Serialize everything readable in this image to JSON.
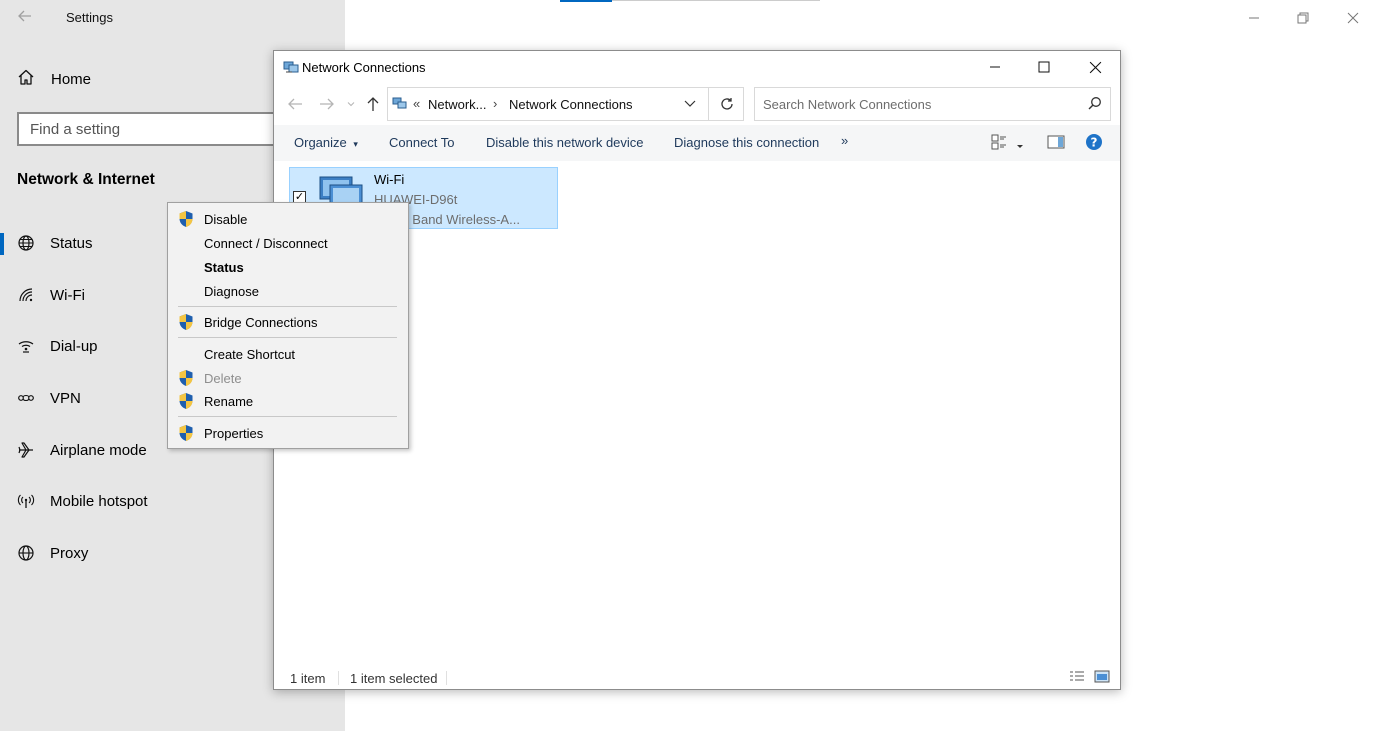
{
  "settings": {
    "title": "Settings",
    "home_label": "Home",
    "search_placeholder": "Find a setting",
    "section_heading": "Network & Internet",
    "nav": [
      {
        "label": "Status",
        "icon": "globe-icon"
      },
      {
        "label": "Wi-Fi",
        "icon": "wifi-icon"
      },
      {
        "label": "Dial-up",
        "icon": "dialup-icon"
      },
      {
        "label": "VPN",
        "icon": "vpn-icon"
      },
      {
        "label": "Airplane mode",
        "icon": "airplane-icon"
      },
      {
        "label": "Mobile hotspot",
        "icon": "hotspot-icon"
      },
      {
        "label": "Proxy",
        "icon": "globe-icon"
      }
    ],
    "active_nav": "Status",
    "accent_color": "#0067c0"
  },
  "explorer": {
    "title": "Network Connections",
    "breadcrumb": {
      "overflow": "«",
      "parent": "Network...",
      "separator": "›",
      "current": "Network Connections"
    },
    "search_placeholder": "Search Network Connections",
    "commands": {
      "organize": "Organize",
      "organize_caret": "▾",
      "connect_to": "Connect To",
      "disable_device": "Disable this network device",
      "diagnose": "Diagnose this connection",
      "more": "»"
    },
    "item": {
      "name": "Wi-Fi",
      "ssid": "HUAWEI-D96t",
      "device": ") Dual Band Wireless-A...",
      "checked": "✓"
    },
    "status": {
      "count": "1 item",
      "selected": "1 item selected"
    },
    "selection_color": "#cce8ff"
  },
  "context_menu": {
    "items": [
      {
        "label": "Disable",
        "shield": true
      },
      {
        "label": "Connect / Disconnect",
        "shield": false
      },
      {
        "label": "Status",
        "bold": true
      },
      {
        "label": "Diagnose",
        "shield": false
      },
      {
        "label": "Bridge Connections",
        "shield": true
      },
      {
        "label": "Create Shortcut",
        "shield": false
      },
      {
        "label": "Delete",
        "shield": true,
        "disabled": true
      },
      {
        "label": "Rename",
        "shield": true
      },
      {
        "label": "Properties",
        "shield": true
      }
    ]
  }
}
